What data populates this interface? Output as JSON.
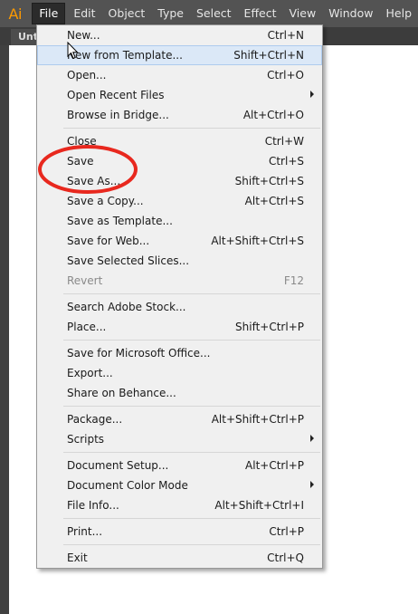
{
  "menubar": {
    "logo": "Ai",
    "items": [
      "File",
      "Edit",
      "Object",
      "Type",
      "Select",
      "Effect",
      "View",
      "Window",
      "Help"
    ]
  },
  "document_tab": "Unt",
  "file_menu": {
    "items": [
      {
        "label": "New...",
        "shortcut": "Ctrl+N"
      },
      {
        "label": "New from Template...",
        "shortcut": "Shift+Ctrl+N"
      },
      {
        "label": "Open...",
        "shortcut": "Ctrl+O"
      },
      {
        "label": "Open Recent Files",
        "shortcut": ""
      },
      {
        "label": "Browse in Bridge...",
        "shortcut": "Alt+Ctrl+O"
      },
      {
        "label": "Close",
        "shortcut": "Ctrl+W"
      },
      {
        "label": "Save",
        "shortcut": "Ctrl+S"
      },
      {
        "label": "Save As...",
        "shortcut": "Shift+Ctrl+S"
      },
      {
        "label": "Save a Copy...",
        "shortcut": "Alt+Ctrl+S"
      },
      {
        "label": "Save as Template...",
        "shortcut": ""
      },
      {
        "label": "Save for Web...",
        "shortcut": "Alt+Shift+Ctrl+S"
      },
      {
        "label": "Save Selected Slices...",
        "shortcut": ""
      },
      {
        "label": "Revert",
        "shortcut": "F12"
      },
      {
        "label": "Search Adobe Stock...",
        "shortcut": ""
      },
      {
        "label": "Place...",
        "shortcut": "Shift+Ctrl+P"
      },
      {
        "label": "Save for Microsoft Office...",
        "shortcut": ""
      },
      {
        "label": "Export...",
        "shortcut": ""
      },
      {
        "label": "Share on Behance...",
        "shortcut": ""
      },
      {
        "label": "Package...",
        "shortcut": "Alt+Shift+Ctrl+P"
      },
      {
        "label": "Scripts",
        "shortcut": ""
      },
      {
        "label": "Document Setup...",
        "shortcut": "Alt+Ctrl+P"
      },
      {
        "label": "Document Color Mode",
        "shortcut": ""
      },
      {
        "label": "File Info...",
        "shortcut": "Alt+Shift+Ctrl+I"
      },
      {
        "label": "Print...",
        "shortcut": "Ctrl+P"
      },
      {
        "label": "Exit",
        "shortcut": "Ctrl+Q"
      }
    ]
  },
  "colors": {
    "menubar_bg": "#535353",
    "logo": "#ff9a00",
    "highlight": "#dbe8f7",
    "annotation_red": "#e8281e"
  }
}
